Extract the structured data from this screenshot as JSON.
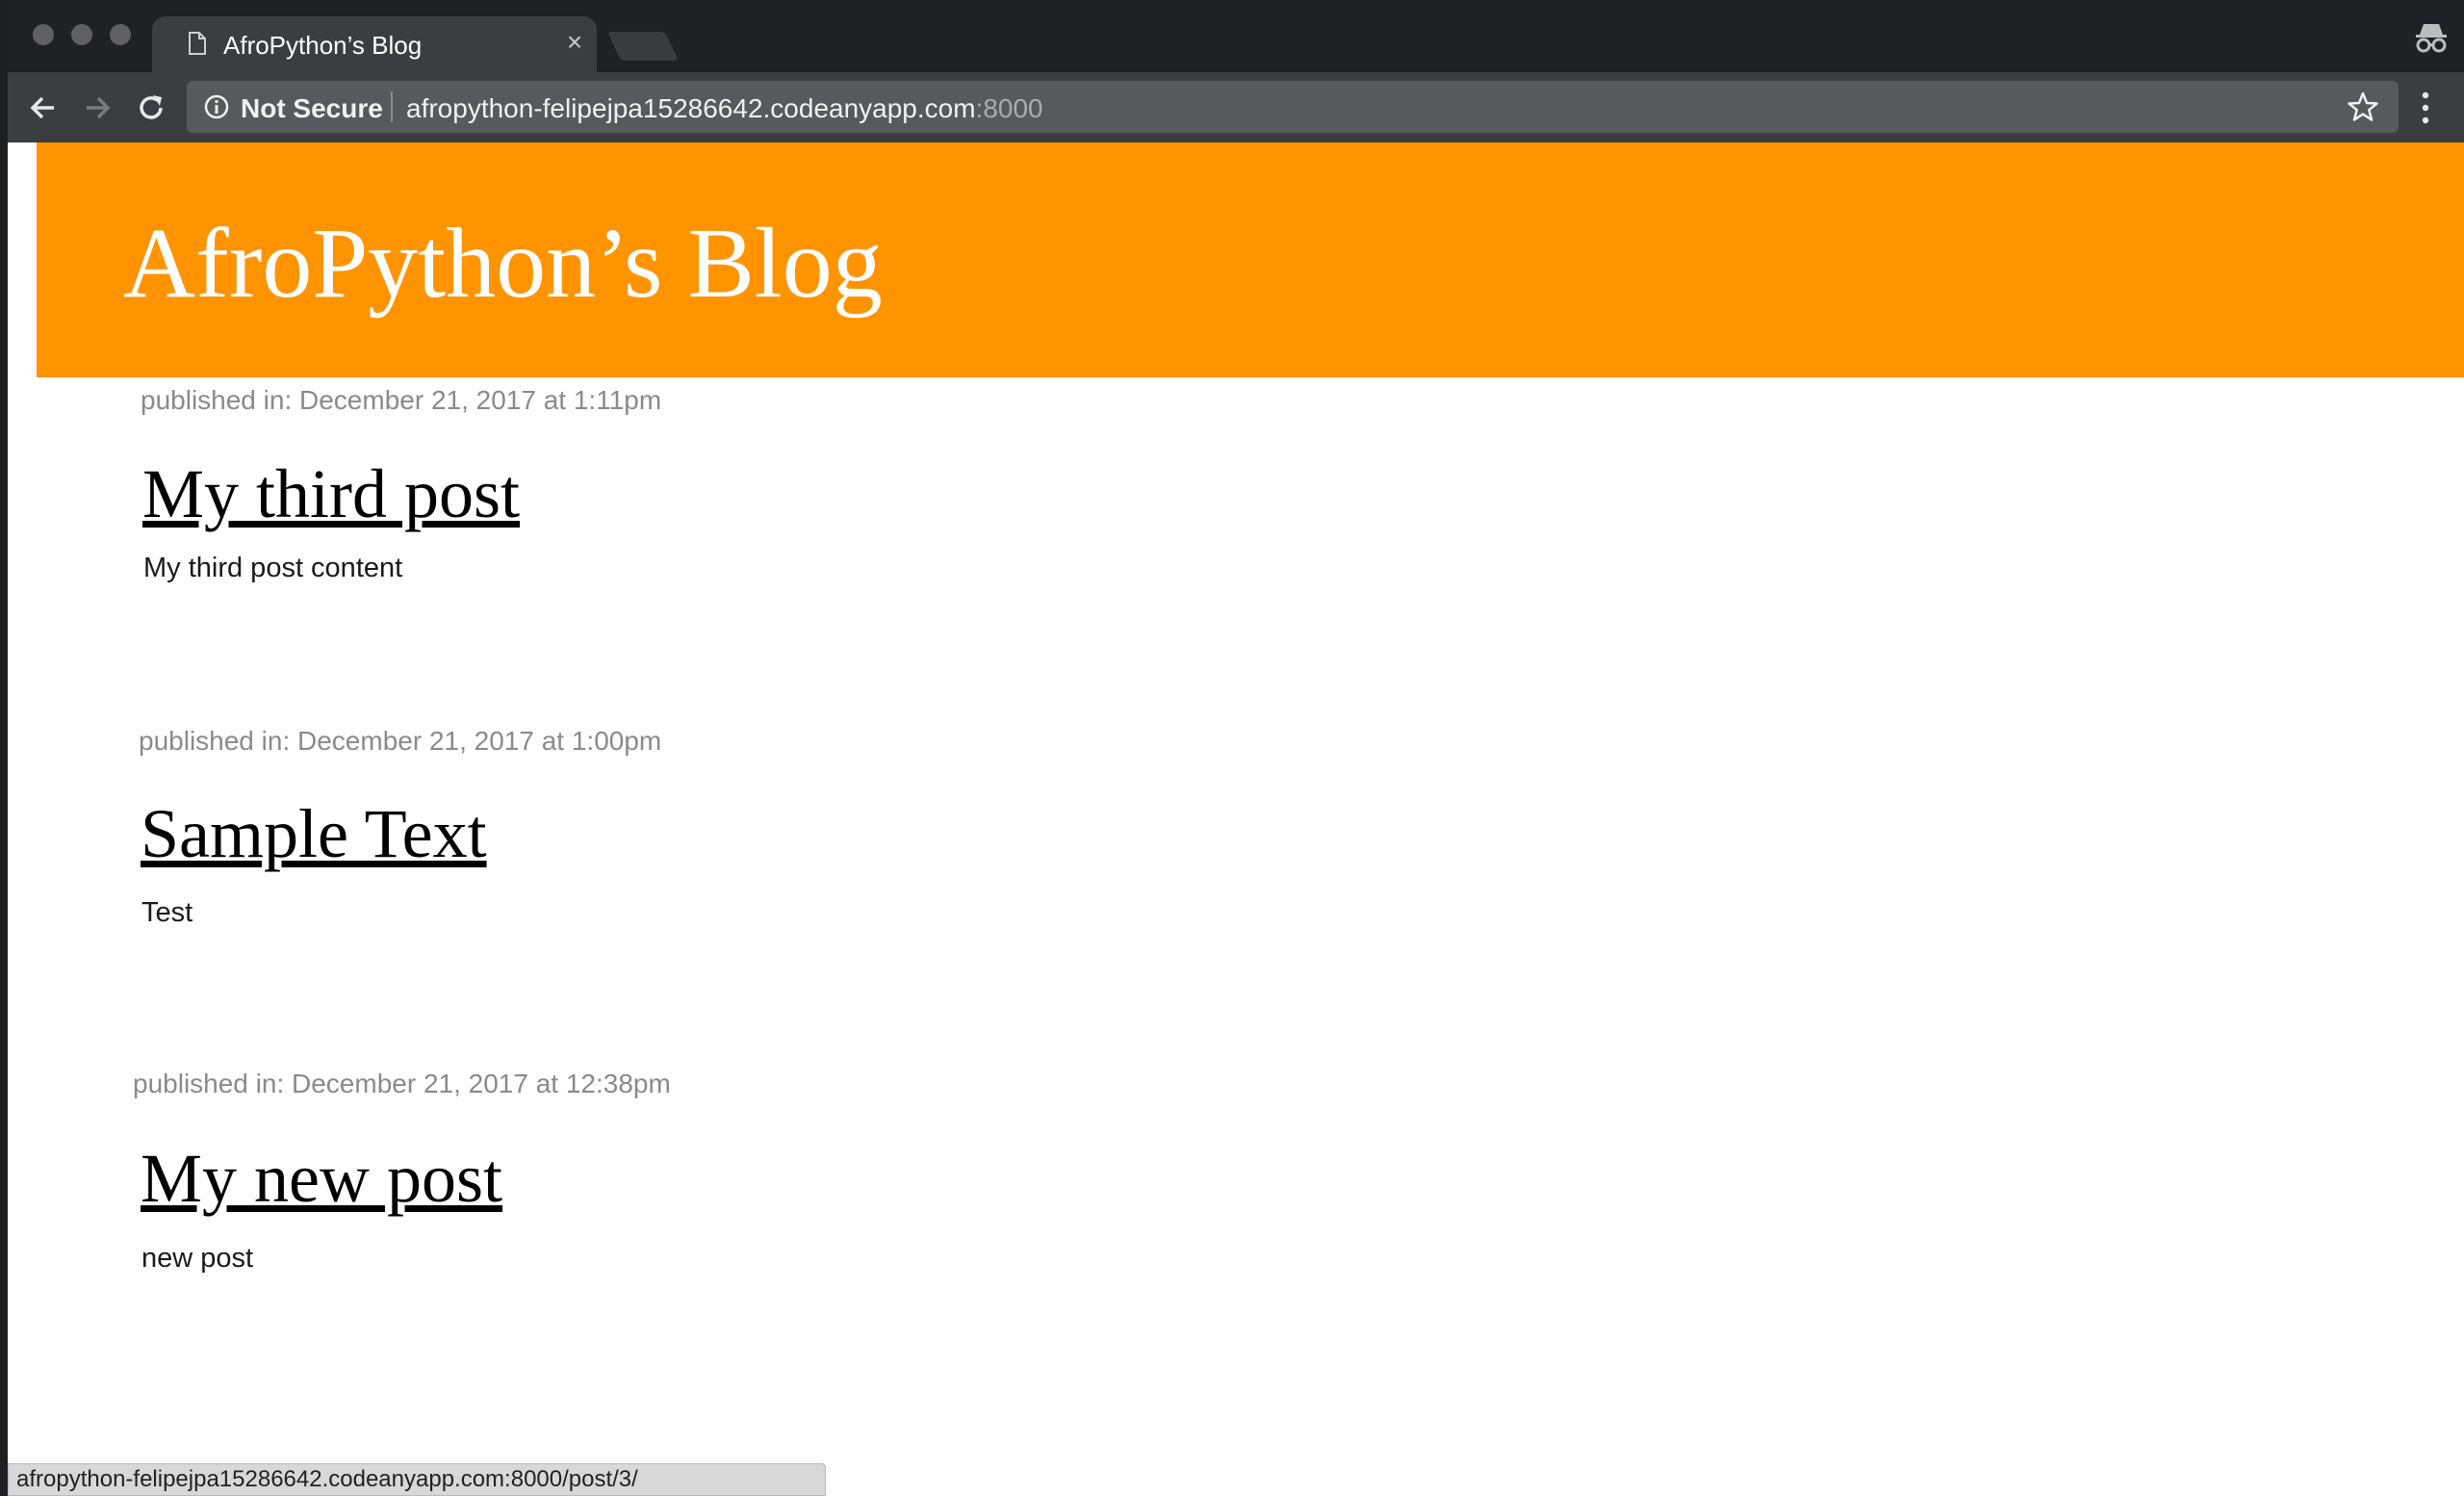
{
  "browser": {
    "tab": {
      "title": "AfroPython’s Blog"
    },
    "toolbar": {
      "security_label": "Not Secure",
      "url_host": "afropython-felipejpa15286642.codeanyapp.com",
      "url_port": ":8000"
    },
    "status_url": "afropython-felipejpa15286642.codeanyapp.com:8000/post/3/"
  },
  "page": {
    "blog_title": "AfroPython’s Blog",
    "header_color": "#ff9400",
    "posts": [
      {
        "date": "published in: December 21, 2017 at 1:11pm",
        "title": "My third post",
        "body": "My third post content"
      },
      {
        "date": "published in: December 21, 2017 at 1:00pm",
        "title": "Sample Text",
        "body": "Test"
      },
      {
        "date": "published in: December 21, 2017 at 12:38pm",
        "title": "My new post",
        "body": "new post"
      }
    ]
  }
}
